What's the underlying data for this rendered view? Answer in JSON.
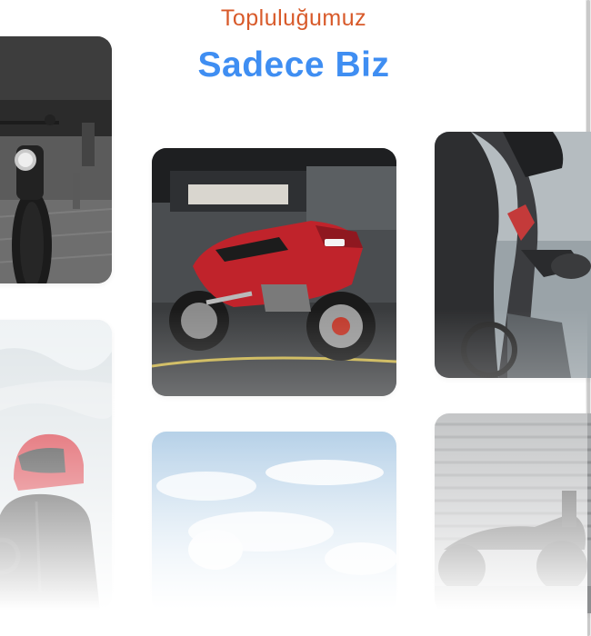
{
  "section": {
    "eyebrow": "Topluluğumuz",
    "title": "Sadece Biz"
  },
  "colors": {
    "eyebrow": "#d85a2a",
    "title": "#3f8ef2",
    "background": "#ffffff"
  },
  "gallery": {
    "photos": [
      {
        "name": "cruiser-motorcycle-photo"
      },
      {
        "name": "red-sport-motorcycle-photo"
      },
      {
        "name": "rider-closeup-photo"
      },
      {
        "name": "red-helmet-rider-photo"
      },
      {
        "name": "sky-clouds-photo"
      },
      {
        "name": "garage-door-motorcycle-photo"
      }
    ]
  }
}
